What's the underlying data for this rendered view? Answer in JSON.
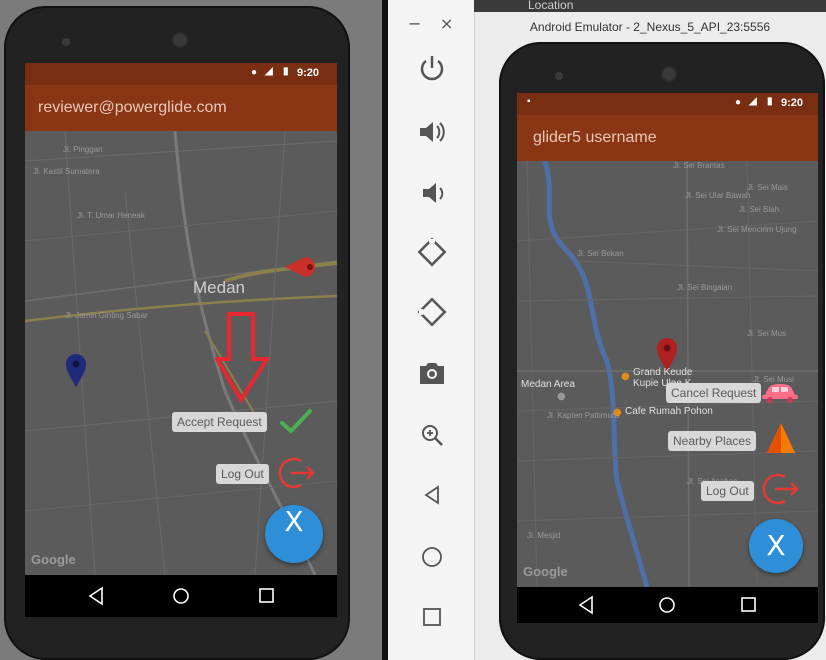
{
  "emulator": {
    "title": "Android Emulator - 2_Nexus_5_API_23:5556",
    "ide_tab": "Location"
  },
  "toolbar": {
    "minimize": "−",
    "close": "×",
    "items": [
      "power-icon",
      "volume-up-icon",
      "volume-down-icon",
      "rotate-left-icon",
      "rotate-right-icon",
      "camera-icon",
      "zoom-icon",
      "back-icon",
      "home-icon",
      "overview-icon"
    ]
  },
  "left_phone": {
    "status_time": "9:20",
    "app_title": "reviewer@powerglide.com",
    "map": {
      "city": "Medan",
      "streets": [
        "Jl. Pinggan",
        "Jl. Kastil Sumatera",
        "Jl. T. Umar Heneak",
        "Jl. Jamin Ginting Sabar"
      ]
    },
    "actions": {
      "accept_label": "Accept Request",
      "logout_label": "Log Out",
      "fab_label": "X"
    },
    "google": "Google",
    "colors": {
      "accent_arrow": "#e8262f",
      "check": "#4caf50",
      "logout": "#e53935",
      "fab": "#2e8fd8"
    }
  },
  "right_phone": {
    "status_time": "9:20",
    "app_title": "glider5 username",
    "map": {
      "places": [
        "Grand Keude Kupie Ulee K...",
        "Cafe Rumah Pohon",
        "Medan Area"
      ],
      "streets": [
        "Jl. Sei Brantas",
        "Jl. Sei Mais",
        "Jl. Sei Blah",
        "Jl. Sei Mencirim Ujung",
        "Jl. Sei Bekan",
        "Jl. Sei Bingaian",
        "Jl. Sei Mus",
        "Jl. Sei Musi",
        "Jl. Sei Asahan",
        "Jl. Kapten Pattimura",
        "Jl. Sei Ular Bawah",
        "Jl. Mesjid"
      ]
    },
    "actions": {
      "cancel_label": "Cancel Request",
      "nearby_label": "Nearby Places",
      "logout_label": "Log Out",
      "fab_label": "X"
    },
    "google": "Google",
    "colors": {
      "car": "#ff6f8a",
      "nearby": "#f57c00",
      "logout": "#e53935",
      "fab": "#2e8fd8"
    }
  }
}
